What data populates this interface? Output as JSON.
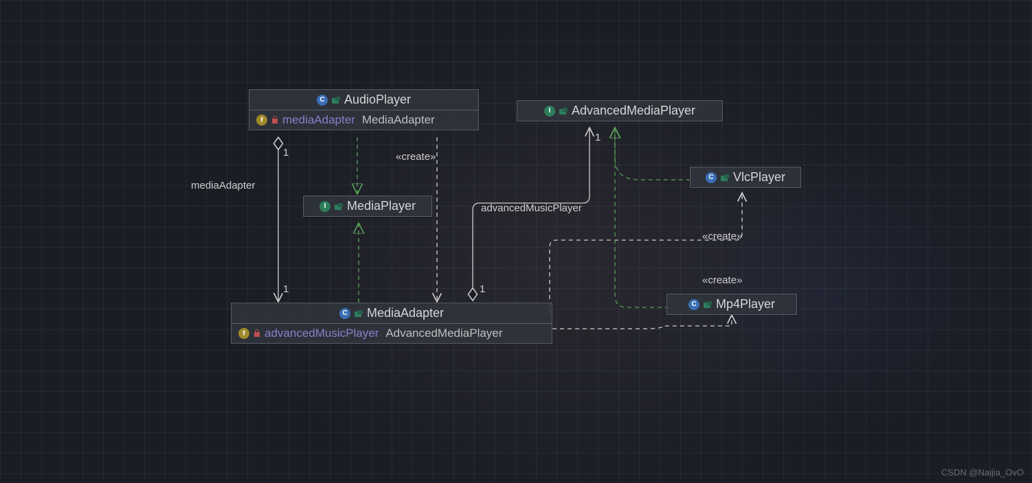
{
  "watermark": "CSDN @Naijia_OvO",
  "labels": {
    "mediaAdapter": "mediaAdapter",
    "advancedMusicPlayer": "advancedMusicPlayer",
    "create1": "«create»",
    "create2": "«create»",
    "create3": "«create»"
  },
  "mult": {
    "m1": "1",
    "m2": "1",
    "m3": "1",
    "m4": "1"
  },
  "nodes": {
    "audioPlayer": {
      "title": "AudioPlayer",
      "type": "class",
      "field": {
        "name": "mediaAdapter",
        "typeName": "MediaAdapter"
      }
    },
    "mediaPlayer": {
      "title": "MediaPlayer",
      "type": "interface"
    },
    "mediaAdapter": {
      "title": "MediaAdapter",
      "type": "class",
      "field": {
        "name": "advancedMusicPlayer",
        "typeName": "AdvancedMediaPlayer"
      }
    },
    "advancedMediaPlayer": {
      "title": "AdvancedMediaPlayer",
      "type": "interface"
    },
    "vlcPlayer": {
      "title": "VlcPlayer",
      "type": "class"
    },
    "mp4Player": {
      "title": "Mp4Player",
      "type": "class"
    }
  },
  "chart_data": {
    "type": "uml-class-diagram",
    "classes": [
      {
        "name": "AudioPlayer",
        "kind": "class",
        "fields": [
          {
            "name": "mediaAdapter",
            "type": "MediaAdapter",
            "visibility": "private"
          }
        ]
      },
      {
        "name": "MediaPlayer",
        "kind": "interface"
      },
      {
        "name": "MediaAdapter",
        "kind": "class",
        "fields": [
          {
            "name": "advancedMusicPlayer",
            "type": "AdvancedMediaPlayer",
            "visibility": "private"
          }
        ]
      },
      {
        "name": "AdvancedMediaPlayer",
        "kind": "interface"
      },
      {
        "name": "VlcPlayer",
        "kind": "class"
      },
      {
        "name": "Mp4Player",
        "kind": "class"
      }
    ],
    "relationships": [
      {
        "from": "AudioPlayer",
        "to": "MediaAdapter",
        "type": "aggregation",
        "role": "mediaAdapter",
        "multiplicity": {
          "from": "1",
          "to": "1"
        }
      },
      {
        "from": "AudioPlayer",
        "to": "MediaPlayer",
        "type": "realization"
      },
      {
        "from": "AudioPlayer",
        "to": "MediaAdapter",
        "type": "dependency",
        "stereotype": "create"
      },
      {
        "from": "MediaAdapter",
        "to": "MediaPlayer",
        "type": "realization"
      },
      {
        "from": "MediaAdapter",
        "to": "AdvancedMediaPlayer",
        "type": "aggregation",
        "role": "advancedMusicPlayer",
        "multiplicity": {
          "from": "1",
          "to": "1"
        }
      },
      {
        "from": "MediaAdapter",
        "to": "VlcPlayer",
        "type": "dependency",
        "stereotype": "create"
      },
      {
        "from": "MediaAdapter",
        "to": "Mp4Player",
        "type": "dependency",
        "stereotype": "create"
      },
      {
        "from": "VlcPlayer",
        "to": "AdvancedMediaPlayer",
        "type": "realization"
      },
      {
        "from": "Mp4Player",
        "to": "AdvancedMediaPlayer",
        "type": "realization"
      }
    ]
  }
}
